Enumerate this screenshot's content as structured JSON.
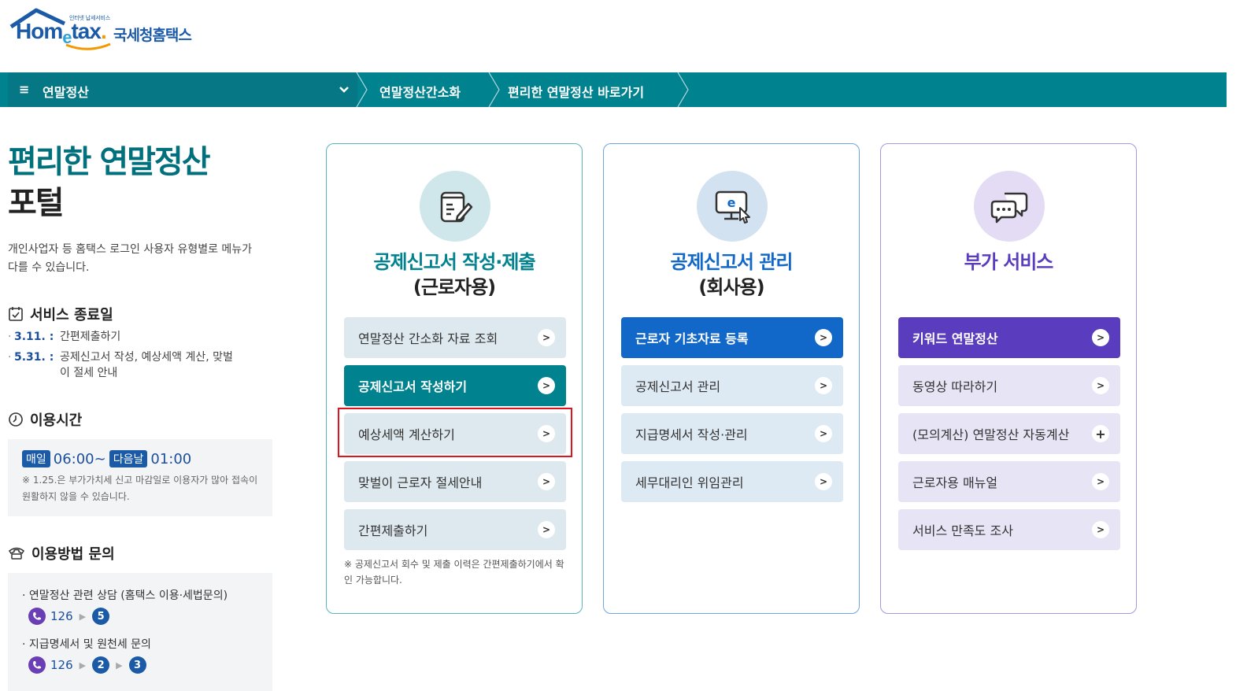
{
  "logo": {
    "small": "인터넷 납세서비스",
    "brand_a": "Hom",
    "brand_e": "e",
    "brand_b": "tax",
    "brand_dot": ".",
    "kor": "국세청홈택스"
  },
  "nav": {
    "menu": "연말정산",
    "crumb1": "연말정산간소화",
    "crumb2": "편리한 연말정산 바로가기"
  },
  "left": {
    "title_line1": "편리한 연말정산",
    "title_line2": "포털",
    "desc": "개인사업자 등 홈택스 로그인 사용자 유형별로 메뉴가 다를 수 있습니다.",
    "end_title": "서비스 종료일",
    "end_items": [
      {
        "bullet": "·",
        "date": "3.11. :",
        "text": "간편제출하기"
      },
      {
        "bullet": "·",
        "date": "5.31. :",
        "text": "공제신고서 작성, 예상세액 계산, 맞벌이 절세 안내"
      }
    ],
    "time_title": "이용시간",
    "time_badge1": "매일",
    "time_start": "06:00~",
    "time_badge2": "다음날",
    "time_end": "01:00",
    "time_note": "※ 1.25.은 부가가치세 신고 마감일로 이용자가 많아 접속이 원활하지 않을 수 있습니다.",
    "inq_title": "이용방법 문의",
    "inq1": "· 연말정산 관련 상담 (홈택스 이용·세법문의)",
    "inq1_phone": "126",
    "inq1_n1": "5",
    "inq2": "· 지급명세서 및 원천세 문의",
    "inq2_phone": "126",
    "inq2_n1": "2",
    "inq2_n2": "3"
  },
  "cards": [
    {
      "title1": "공제신고서 작성·제출",
      "title2": "(근로자용)",
      "buttons": [
        {
          "label": "연말정산 간소화 자료 조회",
          "icon": ">"
        },
        {
          "label": "공제신고서 작성하기",
          "icon": ">"
        },
        {
          "label": "예상세액 계산하기",
          "icon": ">"
        },
        {
          "label": "맞벌이 근로자 절세안내",
          "icon": ">"
        },
        {
          "label": "간편제출하기",
          "icon": ">"
        }
      ],
      "note": "※ 공제신고서 회수 및 제출 이력은 간편제출하기에서 확인 가능합니다."
    },
    {
      "title1": "공제신고서 관리",
      "title2": "(회사용)",
      "buttons": [
        {
          "label": "근로자 기초자료 등록",
          "icon": ">"
        },
        {
          "label": "공제신고서 관리",
          "icon": ">"
        },
        {
          "label": "지급명세서 작성·관리",
          "icon": ">"
        },
        {
          "label": "세무대리인 위임관리",
          "icon": ">"
        }
      ]
    },
    {
      "title1": "부가 서비스",
      "buttons": [
        {
          "label": "키워드 연말정산",
          "icon": ">"
        },
        {
          "label": "동영상 따라하기",
          "icon": ">"
        },
        {
          "label": "(모의계산) 연말정산 자동계산",
          "icon": "+"
        },
        {
          "label": "근로자용 매뉴얼",
          "icon": ">"
        },
        {
          "label": "서비스 만족도 조사",
          "icon": ">"
        }
      ]
    }
  ],
  "colors": {
    "teal": "#00828f",
    "blue": "#1168c8",
    "purple": "#5a3dbf",
    "teal_light": "#dde9ee",
    "blue_light": "#dde9f3",
    "purple_light": "#e7e4f6",
    "highlight": "#e0141e"
  }
}
